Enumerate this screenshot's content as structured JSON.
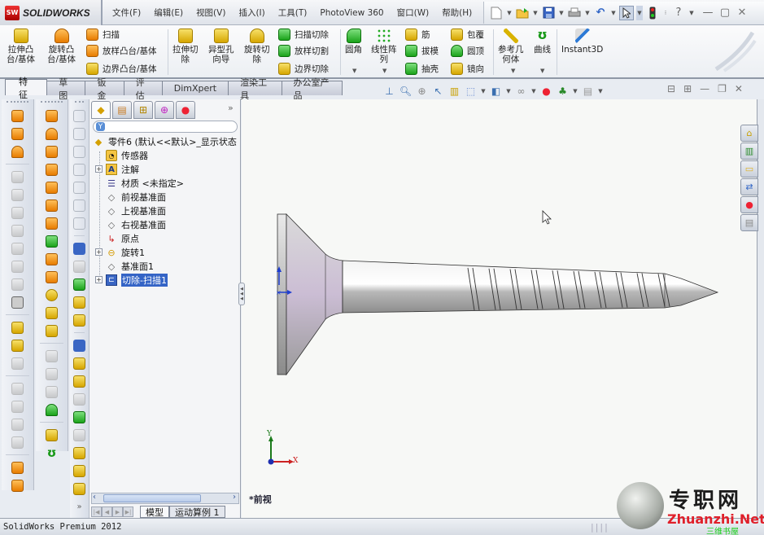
{
  "app": {
    "logo_text": "SOLIDWORKS",
    "logo_badge": "SW"
  },
  "menu": [
    "文件(F)",
    "编辑(E)",
    "视图(V)",
    "插入(I)",
    "工具(T)",
    "PhotoView 360",
    "窗口(W)",
    "帮助(H)"
  ],
  "quick_access": [
    {
      "name": "new",
      "icon": "new-document-icon"
    },
    {
      "name": "open",
      "icon": "open-folder-icon"
    },
    {
      "name": "save",
      "icon": "save-icon"
    },
    {
      "name": "print",
      "icon": "print-icon"
    },
    {
      "name": "undo",
      "icon": "undo-icon"
    },
    {
      "name": "select",
      "icon": "cursor-icon"
    },
    {
      "name": "rebuild",
      "icon": "traffic-light-icon"
    },
    {
      "name": "help",
      "icon": "help-icon"
    }
  ],
  "window_controls": {
    "minimize": "—",
    "restore": "▢",
    "close": "✕"
  },
  "command_manager": {
    "big_buttons": [
      {
        "id": "extrude-boss",
        "label": "拉伸凸\n台/基体"
      },
      {
        "id": "revolve-boss",
        "label": "旋转凸\n台/基体"
      },
      {
        "id": "extrude-cut",
        "label": "拉伸切\n除"
      },
      {
        "id": "hole-wizard",
        "label": "异型孔\n向导"
      },
      {
        "id": "revolve-cut",
        "label": "旋转切\n除"
      },
      {
        "id": "fillet",
        "label": "圆角"
      },
      {
        "id": "linear-pattern",
        "label": "线性阵\n列"
      },
      {
        "id": "reference-geometry",
        "label": "参考几\n何体"
      },
      {
        "id": "curves",
        "label": "曲线"
      },
      {
        "id": "instant3d",
        "label": "Instant3D"
      }
    ],
    "small_buttons": {
      "sweep": "扫描",
      "loft": "放样凸台/基体",
      "boundary_boss": "边界凸台/基体",
      "swept_cut": "扫描切除",
      "lofted_cut": "放样切割",
      "boundary_cut": "边界切除",
      "rib": "筋",
      "draft": "拔模",
      "shell": "抽壳",
      "wrap": "包覆",
      "dome": "圆顶",
      "mirror": "镜向"
    }
  },
  "tabs": [
    {
      "label": "特征",
      "active": true
    },
    {
      "label": "草图",
      "active": false
    },
    {
      "label": "钣金",
      "active": false
    },
    {
      "label": "评估",
      "active": false
    },
    {
      "label": "DimXpert",
      "active": false
    },
    {
      "label": "渲染工具",
      "active": false
    },
    {
      "label": "办公室产品",
      "active": false
    }
  ],
  "view_toolbar": [
    "normal-to-icon",
    "zoom-to-fit-icon",
    "zoom-to-area-icon",
    "previous-view-icon",
    "section-view-icon",
    "view-orientation-icon",
    "display-style-icon",
    "hide-show-items-icon",
    "edit-appearance-icon",
    "apply-scene-icon",
    "view-settings-icon"
  ],
  "feature_tree": {
    "root": "零件6  (默认<<默认>_显示状态",
    "items": [
      {
        "label": "传感器",
        "icon": "sensor-icon",
        "expandable": false
      },
      {
        "label": "注解",
        "icon": "annotation-icon",
        "expandable": true
      },
      {
        "label": "材质 <未指定>",
        "icon": "material-icon",
        "expandable": false
      },
      {
        "label": "前视基准面",
        "icon": "plane-icon",
        "expandable": false
      },
      {
        "label": "上视基准面",
        "icon": "plane-icon",
        "expandable": false
      },
      {
        "label": "右视基准面",
        "icon": "plane-icon",
        "expandable": false
      },
      {
        "label": "原点",
        "icon": "origin-icon",
        "expandable": false
      },
      {
        "label": "旋转1",
        "icon": "revolve-icon",
        "expandable": true
      },
      {
        "label": "基准面1",
        "icon": "plane-icon",
        "expandable": false
      },
      {
        "label": "切除-扫描1",
        "icon": "cut-sweep-icon",
        "expandable": true,
        "selected": true
      }
    ],
    "bottom_tabs": [
      {
        "label": "模型",
        "active": true
      },
      {
        "label": "运动算例 1",
        "active": false
      }
    ]
  },
  "graphics": {
    "view_label": "*前视",
    "triad": {
      "x": "X",
      "y": "Y"
    },
    "model": "screw-model"
  },
  "task_pane": [
    "solidworks-resources-icon",
    "design-library-icon",
    "file-explorer-icon",
    "view-palette-icon",
    "appearances-icon",
    "custom-properties-icon"
  ],
  "status_bar": {
    "text": "SolidWorks Premium 2012",
    "bars": "||||"
  },
  "watermark": {
    "chinese": "专职网",
    "english": "Zhuanzhi.Net",
    "subtitle": "三维书屋"
  }
}
